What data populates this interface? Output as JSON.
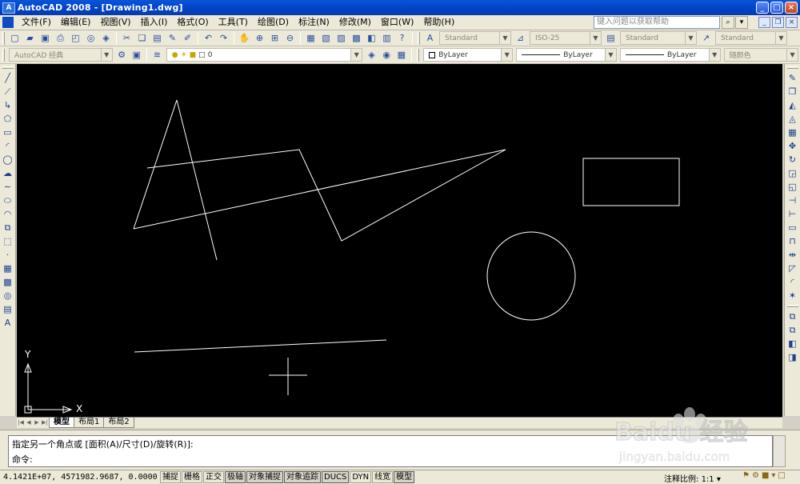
{
  "window": {
    "title": "AutoCAD 2008 - [Drawing1.dwg]",
    "app_icon": "A",
    "buttons": [
      "_",
      "□",
      "×"
    ]
  },
  "menu": {
    "items": [
      "文件(F)",
      "编辑(E)",
      "视图(V)",
      "插入(I)",
      "格式(O)",
      "工具(T)",
      "绘图(D)",
      "标注(N)",
      "修改(M)",
      "窗口(W)",
      "帮助(H)"
    ],
    "help_search_placeholder": "键入问题以获取帮助"
  },
  "toolbar1": {
    "text_style": "Standard",
    "dim_style": "ISO-25",
    "table_style": "Standard",
    "multileader_style": "Standard"
  },
  "toolbar2": {
    "workspace": "AutoCAD 经典",
    "layer": "0",
    "color": "ByLayer",
    "linetype": "ByLayer",
    "lineweight": "ByLayer",
    "plotstyle": "随颜色"
  },
  "tabs": {
    "items": [
      "模型",
      "布局1",
      "布局2"
    ],
    "active": "模型"
  },
  "command": {
    "history": "指定另一个角点或 [面积(A)/尺寸(D)/旋转(R)]:",
    "prompt": "命令:"
  },
  "ucs": {
    "x_label": "X",
    "y_label": "Y"
  },
  "status": {
    "coords": "4.1421E+07, 4571982.9687, 0.0000",
    "toggles": [
      "捕捉",
      "栅格",
      "正交",
      "极轴",
      "对象捕捉",
      "对象追踪",
      "DUCS",
      "DYN",
      "线宽",
      "模型"
    ],
    "annotation_scale_label": "注释比例:",
    "annotation_scale": "1:1"
  },
  "watermark": {
    "brand": "Baidu 经验",
    "url": "jingyan.baidu.com"
  },
  "colors": {
    "canvas": "#000000",
    "stroke": "#ffffff",
    "chrome": "#ece9d8",
    "titlebar": "#0a54d8"
  }
}
